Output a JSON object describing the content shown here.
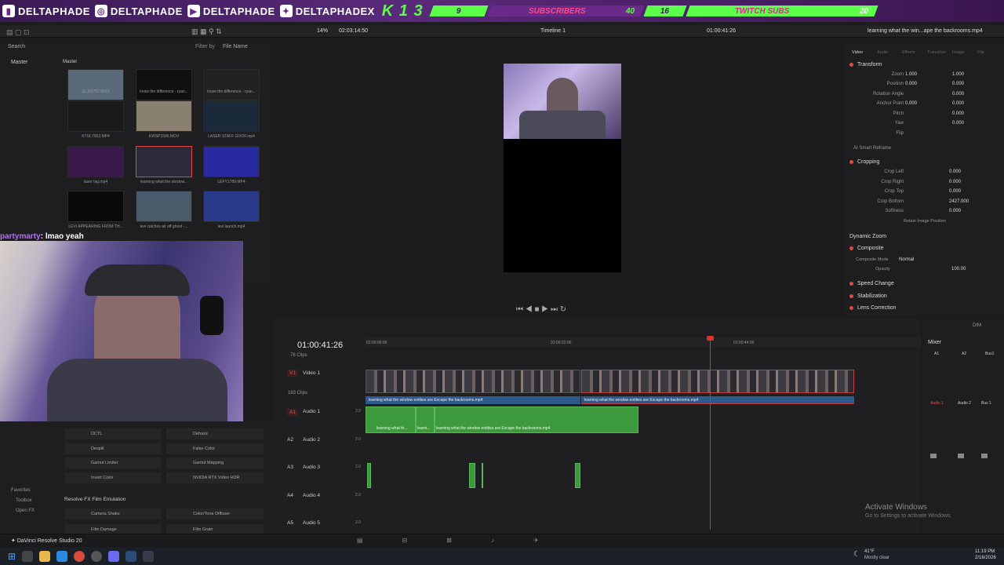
{
  "banner": {
    "handles": [
      {
        "icon": "twitch",
        "text": "DELTAPHADE"
      },
      {
        "icon": "instagram",
        "text": "DELTAPHADE"
      },
      {
        "icon": "youtube",
        "text": "DELTAPHADE"
      },
      {
        "icon": "twitter",
        "text": "DELTAPHADEX"
      }
    ],
    "k13": "K 1 3",
    "subs_label": "SUBSCRIBERS",
    "subs_left": "9",
    "subs_right": "40",
    "twitch_label": "TWITCH SUBS",
    "twitch_left": "16",
    "twitch_right": "20"
  },
  "toolbar": {
    "zoom": "14%",
    "timecode": "02:03:14:50",
    "timeline_name": "Timeline 1",
    "timeline_tc": "01:00:41:26",
    "clip_title": "learning what the win...ape the backrooms.mp4"
  },
  "media_pool": {
    "search": "Search",
    "filter_label": "Filter by",
    "filter_value": "File Name",
    "master_left": "Master",
    "master_bin": "Master",
    "clips": [
      "XLJF5757.MOV",
      "know the difference - ryan...",
      "know the difference - ryan...",
      "KTUL7052.MP4",
      "KWSP1586.MOV",
      "LASER STAFF GOOF.mp4",
      "laser tag.mp4",
      "learning what the window...",
      "LEFY1789.MP4",
      "LEVI APPEARING FROM TH...",
      "levi catches air off ghost -...",
      "levi launch.mp4"
    ]
  },
  "chat": {
    "user": "partymarty",
    "message": "lmao yeah"
  },
  "effects": {
    "left": [
      "DCTL",
      "Despill",
      "Gamut Limiter",
      "Invert Color"
    ],
    "right": [
      "Dehaze",
      "False Color",
      "Gamut Mapping",
      "NVIDIA RTX Video HDR"
    ],
    "section": "Resolve FX Film Emulation",
    "left2": [
      "Camera Shake",
      "Film Damage"
    ],
    "right2": [
      "Color/Tone Diffuser",
      "Film Grain"
    ],
    "favorites": "Favorites",
    "toolbox": "Toolbox",
    "openfx": "Open FX"
  },
  "inspector": {
    "tabs": [
      "Video",
      "Audio",
      "Effects",
      "Transition",
      "Image",
      "File"
    ],
    "transform": "Transform",
    "rows": [
      {
        "label": "Zoom",
        "x": "1.000",
        "y": "1.000"
      },
      {
        "label": "Position",
        "x": "0.000",
        "y": "0.000"
      },
      {
        "label": "Rotation Angle",
        "y": "0.000"
      },
      {
        "label": "Anchor Point",
        "x": "0.000",
        "y": "0.000"
      },
      {
        "label": "Pitch",
        "y": "0.000"
      },
      {
        "label": "Yaw",
        "y": "0.000"
      },
      {
        "label": "Flip"
      }
    ],
    "smart_reframe": "AI Smart Reframe",
    "cropping": "Cropping",
    "crop_rows": [
      {
        "label": "Crop Left",
        "v": "0.000"
      },
      {
        "label": "Crop Right",
        "v": "0.000"
      },
      {
        "label": "Crop Top",
        "v": "0.000"
      },
      {
        "label": "Crop Bottom",
        "v": "2427.000"
      },
      {
        "label": "Softness",
        "v": "0.000"
      }
    ],
    "retain": "Retain Image Position",
    "dynamic_zoom": "Dynamic Zoom",
    "composite": "Composite",
    "composite_mode_label": "Composite Mode",
    "composite_mode": "Normal",
    "opacity_label": "Opacity",
    "opacity": "100.00",
    "speed": "Speed Change",
    "stabilization": "Stabilization",
    "lens": "Lens Correction"
  },
  "timeline": {
    "tc": "01:00:41:26",
    "ruler": [
      "01:00:00:00",
      "01:00:22:00",
      "01:00:44:00"
    ],
    "v1_name": "Video 1",
    "v1_clips": "78 Clips",
    "v1_clips2": "183 Clips",
    "clip_name": "learning what the window entities are Escape the backrooms.mp4",
    "clip_name_short": "learning what th...",
    "clip_name_short2": "learni...",
    "audio_tracks": [
      {
        "id": "A1",
        "name": "Audio 1",
        "ch": "2.0"
      },
      {
        "id": "A2",
        "name": "Audio 2",
        "ch": "2.0"
      },
      {
        "id": "A3",
        "name": "Audio 3",
        "ch": "2.0"
      },
      {
        "id": "A4",
        "name": "Audio 4",
        "ch": "2.0"
      },
      {
        "id": "A5",
        "name": "Audio 5",
        "ch": "2.0"
      }
    ],
    "v1_id": "V1"
  },
  "mixer": {
    "title": "Mixer",
    "labels": [
      "A1",
      "A2",
      "Bus1"
    ],
    "labels2": [
      "Audio 1",
      "Audio 2",
      "Bus 1"
    ],
    "dim": "DIM"
  },
  "watermark": {
    "line1": "Activate Windows",
    "line2": "Go to Settings to activate Windows."
  },
  "app_name": "DaVinci Resolve Studio 20",
  "taskbar": {
    "weather_temp": "41°F",
    "weather_desc": "Mostly clear",
    "time": "11:19 PM",
    "date": "2/16/2026"
  }
}
